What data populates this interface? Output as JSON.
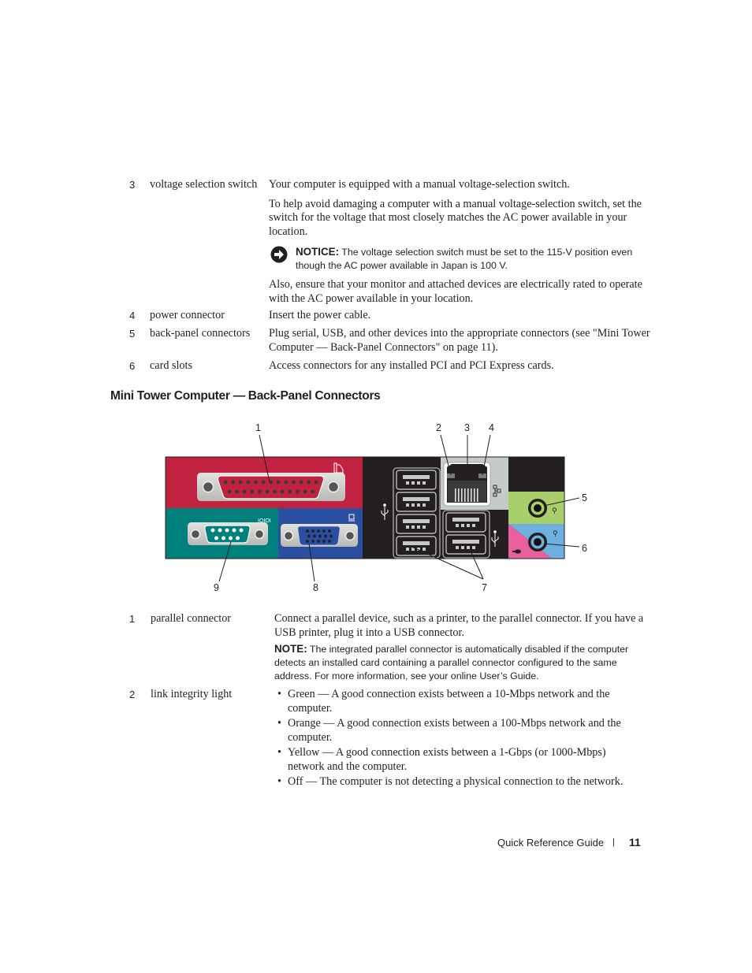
{
  "top_table": {
    "rows": [
      {
        "number": "3",
        "term": "voltage selection switch",
        "paragraphs": [
          "Your computer is equipped with a manual voltage-selection switch.",
          "To help avoid damaging a computer with a manual voltage-selection switch, set the switch for the voltage that most closely matches the AC power available in your location."
        ],
        "notice": {
          "icon": "notice-arrow-icon",
          "label": "NOTICE:",
          "text": "The voltage selection switch must be set to the 115-V position even though the AC power available in Japan is 100 V."
        },
        "after_notice": "Also, ensure that your monitor and attached devices are electrically rated to operate with the AC power available in your location."
      },
      {
        "number": "4",
        "term": "power connector",
        "description": "Insert the power cable."
      },
      {
        "number": "5",
        "term": "back-panel connectors",
        "description": "Plug serial, USB, and other devices into the appropriate connectors (see \"Mini Tower Computer — Back-Panel Connectors\" on page 11)."
      },
      {
        "number": "6",
        "term": "card slots",
        "description": "Access connectors for any installed PCI and PCI Express cards."
      }
    ]
  },
  "section_title": "Mini Tower Computer — Back-Panel Connectors",
  "diagram": {
    "callouts": [
      "1",
      "2",
      "3",
      "4",
      "5",
      "6",
      "7",
      "8",
      "9"
    ],
    "colors": {
      "parallel_panel": "#c0223f",
      "serial_panel": "#00807c",
      "video_panel": "#2a4ea0",
      "black_panel": "#231f20",
      "network_panel": "#c5cbc7",
      "line_out_panel": "#a9cf6a",
      "line_in_blue": "#6fb0e0",
      "line_in_pink": "#e8609c",
      "connector_metal": "#c8c8c4"
    }
  },
  "bottom_table": {
    "rows": [
      {
        "number": "1",
        "term": "parallel connector",
        "description": "Connect a parallel device, such as a printer, to the parallel connector. If you have a USB printer, plug it into a USB connector.",
        "note": {
          "label": "NOTE:",
          "text": "The integrated parallel connector is automatically disabled if the computer detects an installed card containing a parallel connector configured to the same address. For more information, see your online User’s Guide."
        }
      },
      {
        "number": "2",
        "term": "link integrity light",
        "bullets": [
          "Green — A good connection exists between a 10-Mbps network and the computer.",
          "Orange — A good connection exists between a 100-Mbps network and the computer.",
          "Yellow — A good connection exists between a 1-Gbps (or 1000-Mbps) network and the computer.",
          "Off — The computer is not detecting a physical connection to the network."
        ]
      }
    ]
  },
  "footer": {
    "guide_title": "Quick Reference Guide",
    "separator": "|",
    "page_number": "11"
  }
}
